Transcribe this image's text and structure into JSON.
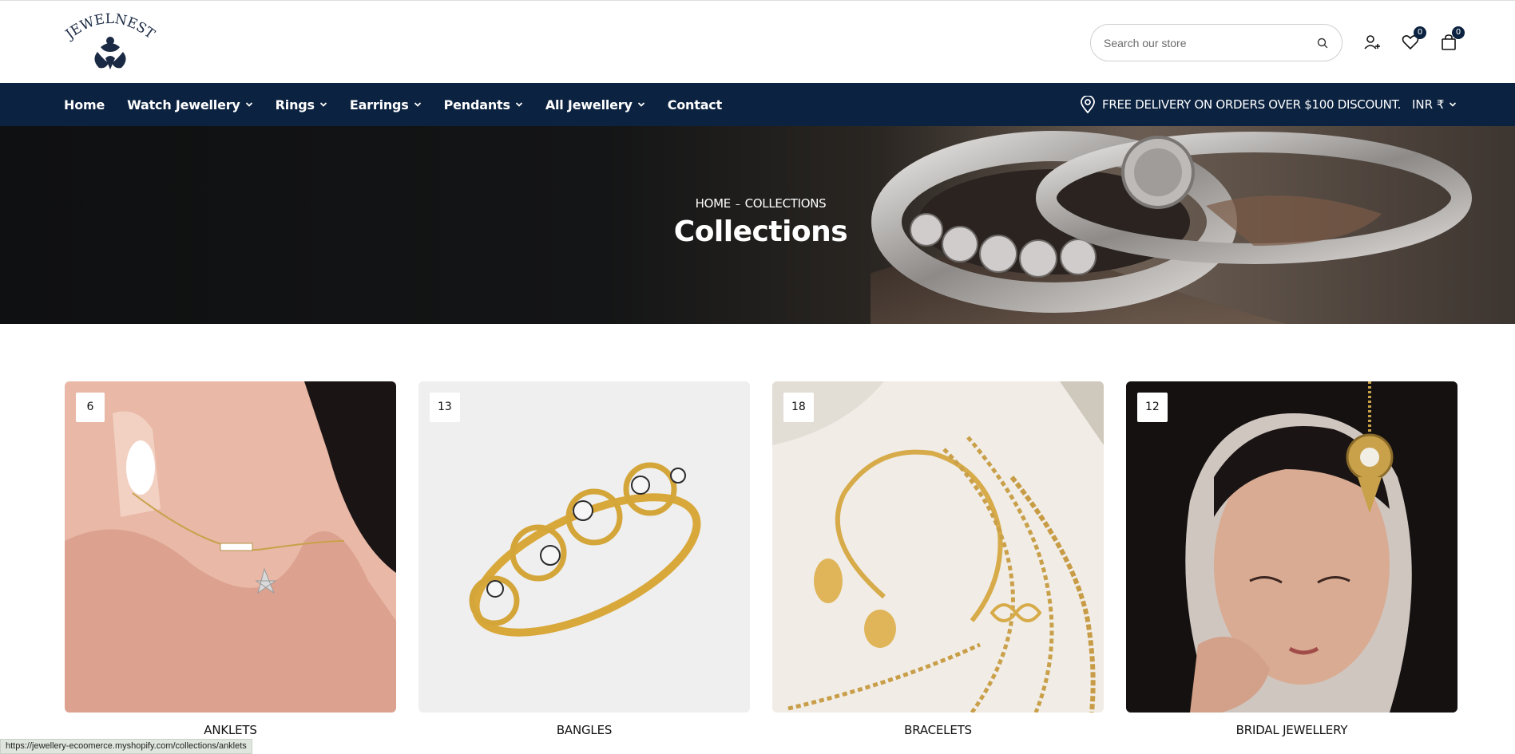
{
  "header": {
    "logo_text": "JEWELNEST",
    "search_placeholder": "Search our store",
    "wishlist_count": "0",
    "cart_count": "0"
  },
  "nav": {
    "items": [
      {
        "label": "Home",
        "has_dropdown": false
      },
      {
        "label": "Watch Jewellery",
        "has_dropdown": true
      },
      {
        "label": "Rings",
        "has_dropdown": true
      },
      {
        "label": "Earrings",
        "has_dropdown": true
      },
      {
        "label": "Pendants",
        "has_dropdown": true
      },
      {
        "label": "All Jewellery",
        "has_dropdown": true
      },
      {
        "label": "Contact",
        "has_dropdown": false
      }
    ],
    "delivery_text": "FREE DELIVERY ON ORDERS OVER $100 DISCOUNT.",
    "currency": "INR ₹"
  },
  "hero": {
    "breadcrumb_home": "HOME",
    "breadcrumb_sep": "–",
    "breadcrumb_current": "COLLECTIONS",
    "title": "Collections"
  },
  "collections": [
    {
      "name": "ANKLETS",
      "count": "6"
    },
    {
      "name": "BANGLES",
      "count": "13"
    },
    {
      "name": "BRACELETS",
      "count": "18"
    },
    {
      "name": "BRIDAL JEWELLERY",
      "count": "12"
    }
  ],
  "status_bar": {
    "url": "https://jewellery-ecoomerce.myshopify.com/collections/anklets"
  },
  "colors": {
    "nav_background": "#0b2240",
    "accent_gold": "#d4a63a"
  }
}
